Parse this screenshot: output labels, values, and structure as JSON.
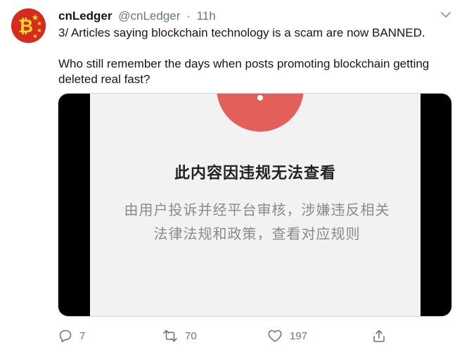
{
  "tweet": {
    "author_name": "cnLedger",
    "handle": "@cnLedger",
    "separator": "·",
    "time": "11h",
    "text_line1": "3/ Articles saying blockchain technology is a scam are now BANNED.",
    "text_line2": "Who still remember the days when posts promoting blockchain getting deleted real fast?",
    "media": {
      "title": "此内容因违规无法查看",
      "description": "由用户投诉并经平台审核，涉嫌违反相关法律法规和政策，查看对应规则"
    },
    "actions": {
      "replies": "7",
      "retweets": "70",
      "likes": "197"
    }
  },
  "colors": {
    "avatar_red": "#d62b1f",
    "star_yellow": "#f7d52a",
    "muted": "#657786",
    "warning_red": "#e35f5a"
  },
  "icons": {
    "reply": "speech-bubble",
    "retweet": "two-arrows-loop",
    "like": "heart-outline",
    "share": "upload-arrow",
    "menu": "chevron-down"
  }
}
